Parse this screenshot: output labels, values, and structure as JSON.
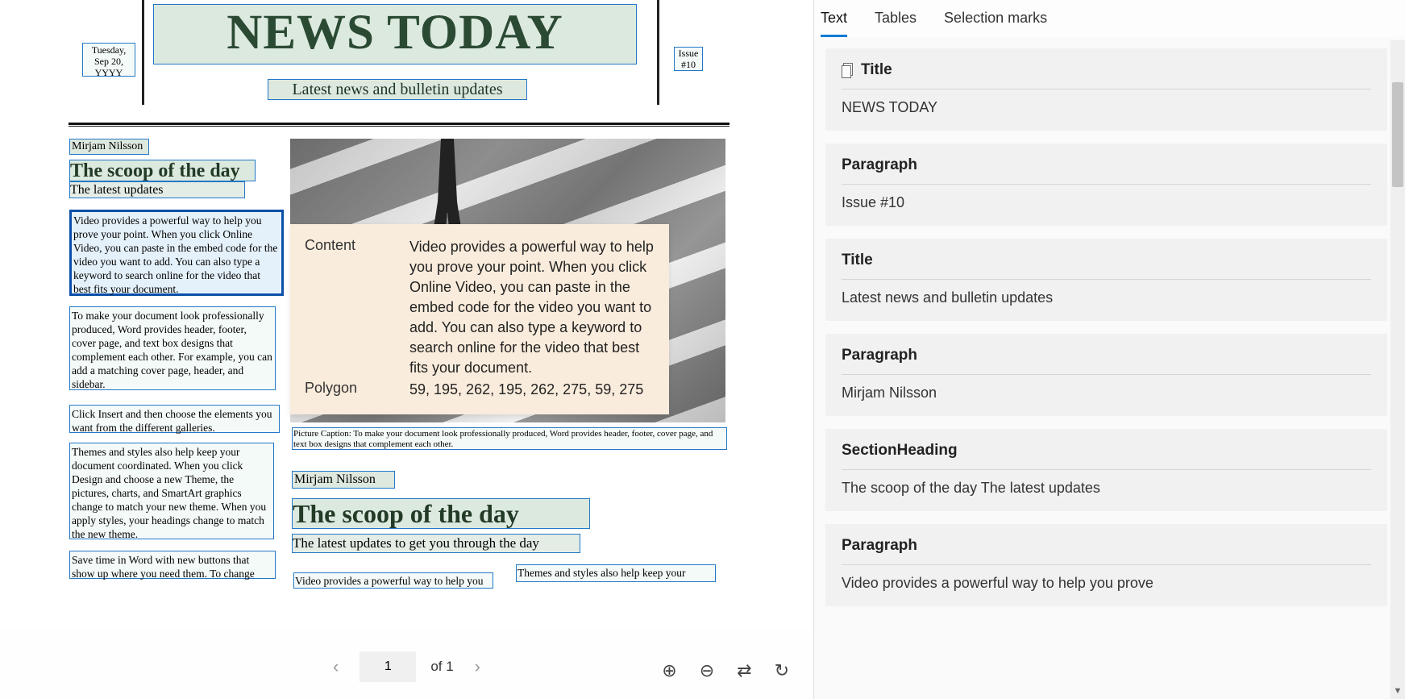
{
  "tabs": {
    "text": "Text",
    "tables": "Tables",
    "selection_marks": "Selection marks"
  },
  "document": {
    "title": "NEWS TODAY",
    "subtitle": "Latest news and bulletin updates",
    "date": "Tuesday, Sep 20, YYYY",
    "issue": "Issue #10",
    "author1": "Mirjam Nilsson",
    "scoop1": "The scoop of the day",
    "latest1": "The latest updates",
    "p1": "Video provides a powerful way to help you prove your point. When you click Online Video, you can paste in the embed code for the video you want to add. You can also type a keyword to search online for the video that best fits your document.",
    "p2": "To make your document look professionally produced, Word provides header, footer, cover page, and text box designs that complement each other. For example, you can add a matching cover page, header, and sidebar.",
    "p3": "Click Insert and then choose the elements you want from the different galleries.",
    "p4": "Themes and styles also help keep your document coordinated. When you click Design and choose a new Theme, the pictures, charts, and SmartArt graphics change to match your new theme. When you apply styles, your headings change to match the new theme.",
    "p5": "Save time in Word with new buttons that show up where you need them. To change",
    "caption": "Picture Caption: To make your document look professionally produced, Word provides header, footer, cover page, and text box designs that complement each other.",
    "author2": "Mirjam Nilsson",
    "scoop2": "The scoop of the day",
    "latest2": "The latest updates to get you through the day",
    "p6": "Themes and styles also help keep your",
    "p7": "Video provides a powerful way to help you"
  },
  "tooltip": {
    "content_label": "Content",
    "content_value": "Video provides a powerful way to help you prove your point. When you click Online Video, you can paste in the embed code for the video you want to add. You can also type a keyword to search online for the video that best fits your document.",
    "polygon_label": "Polygon",
    "polygon_value": "59, 195, 262, 195, 262, 275, 59, 275"
  },
  "pagination": {
    "current": "1",
    "of": "of 1"
  },
  "results": [
    {
      "type": "Title",
      "icon": true,
      "content": "NEWS TODAY"
    },
    {
      "type": "Paragraph",
      "content": "Issue #10"
    },
    {
      "type": "Title",
      "content": "Latest news and bulletin updates"
    },
    {
      "type": "Paragraph",
      "content": "Mirjam Nilsson"
    },
    {
      "type": "SectionHeading",
      "content": "The scoop of the day The latest updates"
    },
    {
      "type": "Paragraph",
      "content": "Video provides a powerful way to help you prove"
    }
  ]
}
